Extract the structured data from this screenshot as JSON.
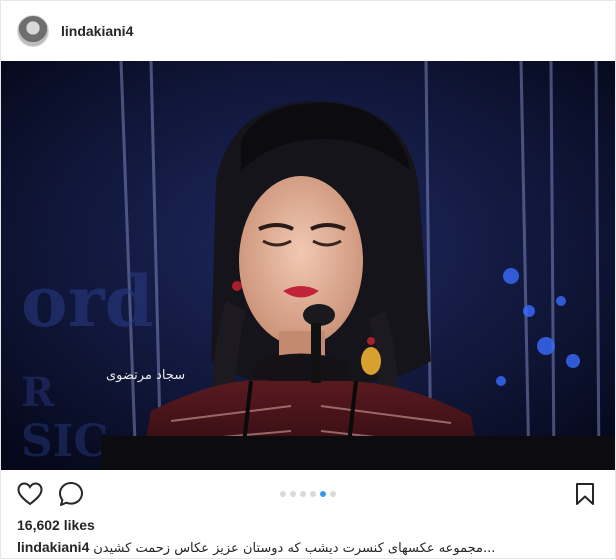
{
  "post": {
    "username": "lindakiani4",
    "likes_text": "16,602 likes",
    "caption": {
      "username": "lindakiani4",
      "text": "...مجموعه عکسهای کنسرت دیشب که دوستان عزیز عکاس زحمت کشیدن"
    },
    "carousel": {
      "total": 6,
      "active_index": 4
    },
    "photo": {
      "watermark_text": "سجاد مرتضوی",
      "background_text": "ord",
      "background_text_2": "R",
      "background_text_3": "SIC"
    }
  },
  "icons": {
    "like": "heart-icon",
    "comment": "speech-bubble-icon",
    "save": "bookmark-icon"
  },
  "colors": {
    "accent": "#3897f0",
    "text": "#262626",
    "border": "#e6e6e6"
  }
}
